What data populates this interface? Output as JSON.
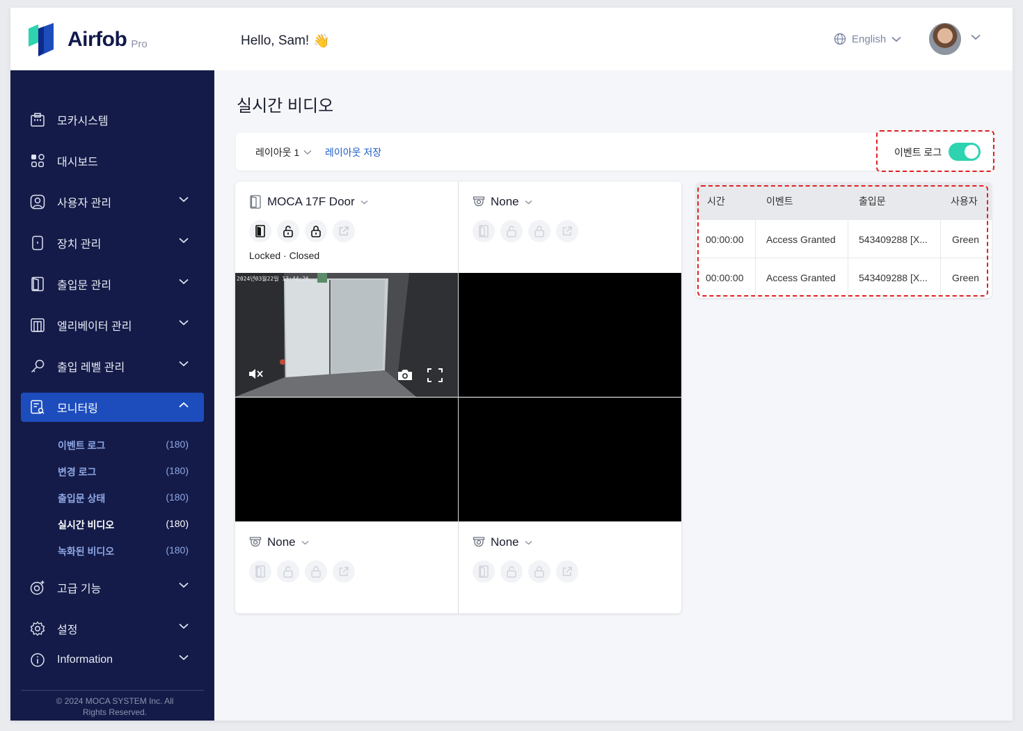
{
  "header": {
    "app_name": "Airfob",
    "app_tier": "Pro",
    "greeting": "Hello, Sam!",
    "greeting_emoji": "👋",
    "language": "English"
  },
  "sidebar": {
    "items": [
      {
        "label": "모카시스템",
        "icon": "building-icon",
        "expandable": false
      },
      {
        "label": "대시보드",
        "icon": "dashboard-icon",
        "expandable": false
      },
      {
        "label": "사용자 관리",
        "icon": "user-icon",
        "expandable": true
      },
      {
        "label": "장치 관리",
        "icon": "device-icon",
        "expandable": true
      },
      {
        "label": "출입문 관리",
        "icon": "door-icon",
        "expandable": true
      },
      {
        "label": "엘리베이터 관리",
        "icon": "elevator-icon",
        "expandable": true
      },
      {
        "label": "출입 레벨 관리",
        "icon": "key-icon",
        "expandable": true
      },
      {
        "label": "모니터링",
        "icon": "monitoring-icon",
        "expandable": true,
        "active": true
      },
      {
        "label": "고급 기능",
        "icon": "advanced-icon",
        "expandable": true
      },
      {
        "label": "설정",
        "icon": "gear-icon",
        "expandable": true
      },
      {
        "label": "Information",
        "icon": "info-icon",
        "expandable": true
      }
    ],
    "monitoring_sub": [
      {
        "label": "이벤트 로그",
        "count": "(180)"
      },
      {
        "label": "변경 로그",
        "count": "(180)"
      },
      {
        "label": "출입문 상태",
        "count": "(180)"
      },
      {
        "label": "실시간 비디오",
        "count": "(180)",
        "current": true
      },
      {
        "label": "녹화된 비디오",
        "count": "(180)"
      }
    ],
    "copyright": "© 2024 MOCA SYSTEM Inc. All Rights Reserved."
  },
  "page": {
    "title": "실시간 비디오",
    "layout_label": "레이아웃 1",
    "save_layout": "레이아웃 저장",
    "event_log_toggle": "이벤트 로그",
    "event_log_on": true
  },
  "cameras": [
    {
      "name": "MOCA 17F Door",
      "status": "Locked · Closed",
      "has_feed": true,
      "timestamp": "2024년03월22일 13:44:26"
    },
    {
      "name": "None",
      "status": "",
      "has_feed": false
    },
    {
      "name": "None",
      "status": "",
      "has_feed": false
    },
    {
      "name": "None",
      "status": "",
      "has_feed": false
    }
  ],
  "events": {
    "columns": [
      "시간",
      "이벤트",
      "출입문",
      "사용자"
    ],
    "rows": [
      [
        "00:00:00",
        "Access Granted",
        "543409288 [X...",
        "Green"
      ],
      [
        "00:00:00",
        "Access Granted",
        "543409288 [X...",
        "Green"
      ]
    ]
  },
  "colors": {
    "sidebar_bg": "#141b48",
    "active_item": "#1d4dbd",
    "toggle_on": "#2ed3b0",
    "link": "#1f5cc7",
    "highlight": "#e02020"
  }
}
